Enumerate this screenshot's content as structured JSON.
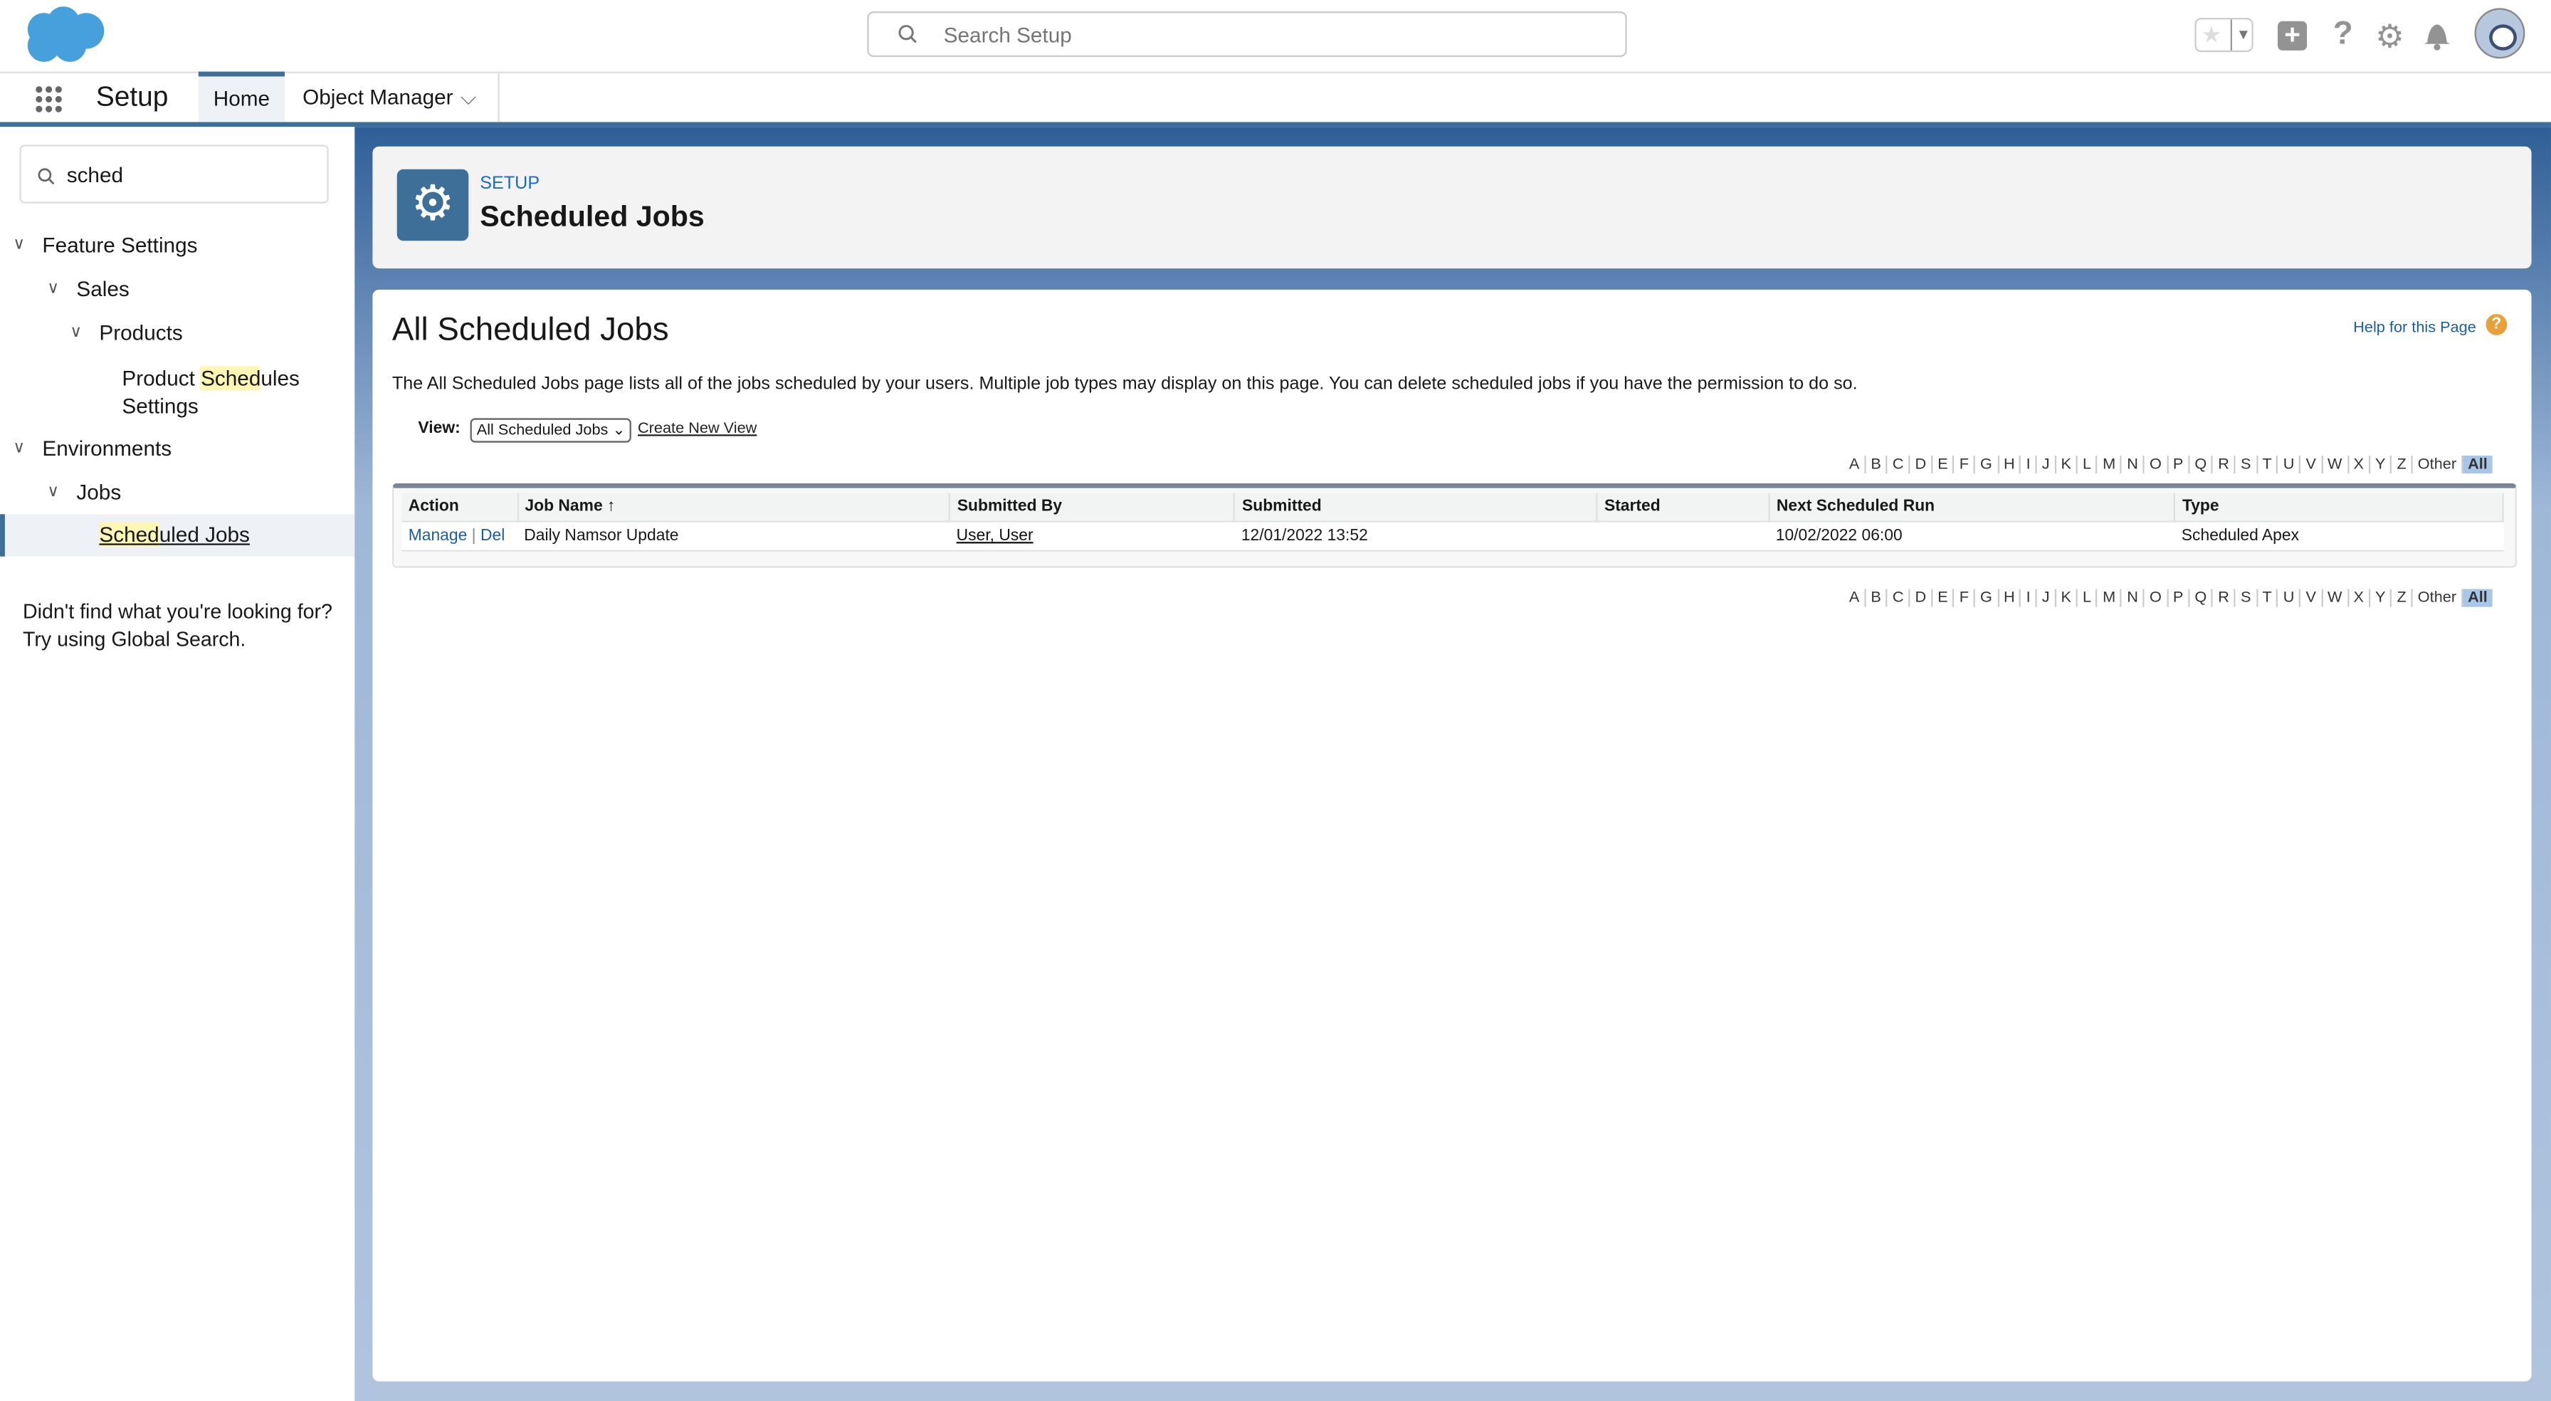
{
  "header": {
    "search_placeholder": "Search Setup",
    "icons": [
      "salesforce-cloud-logo",
      "star-icon",
      "plus-icon",
      "help-icon",
      "gear-icon",
      "bell-icon",
      "avatar"
    ]
  },
  "nav": {
    "app_name": "Setup",
    "tabs": [
      {
        "label": "Home"
      },
      {
        "label": "Object Manager"
      }
    ]
  },
  "sidebar": {
    "quickfind_value": "sched",
    "tree": [
      {
        "label": "Feature Settings"
      },
      {
        "label": "Sales"
      },
      {
        "label": "Products"
      },
      {
        "pre": "Product ",
        "hl": "Sched",
        "post": "ules",
        "line2": "Settings"
      },
      {
        "label": "Environments"
      },
      {
        "label": "Jobs"
      },
      {
        "pre": "",
        "hl": "Sched",
        "post": "uled Jobs"
      }
    ],
    "not_found_line1": "Didn't find what you're looking for?",
    "not_found_line2": "Try using Global Search."
  },
  "page_header": {
    "eyebrow": "SETUP",
    "title": "Scheduled Jobs"
  },
  "content": {
    "title": "All Scheduled Jobs",
    "help_link": "Help for this Page",
    "description": "The All Scheduled Jobs page lists all of the jobs scheduled by your users. Multiple job types may display on this page. You can delete scheduled jobs if you have the permission to do so.",
    "view_label": "View:",
    "view_selected": "All Scheduled Jobs",
    "create_view": "Create New View",
    "alpha": [
      "A",
      "B",
      "C",
      "D",
      "E",
      "F",
      "G",
      "H",
      "I",
      "J",
      "K",
      "L",
      "M",
      "N",
      "O",
      "P",
      "Q",
      "R",
      "S",
      "T",
      "U",
      "V",
      "W",
      "X",
      "Y",
      "Z",
      "Other",
      "All"
    ],
    "table": {
      "columns": [
        "Action",
        "Job Name ↑",
        "Submitted By",
        "Submitted",
        "Started",
        "Next Scheduled Run",
        "Type"
      ],
      "rows": [
        {
          "manage": "Manage",
          "sep": "|",
          "del": "Del",
          "job_name": "Daily Namsor Update",
          "submitted_by": "User, User",
          "submitted": "12/01/2022 13:52",
          "started": "",
          "next_run": "10/02/2022 06:00",
          "type": "Scheduled Apex"
        }
      ]
    }
  },
  "colors": {
    "brand_blue": "#3e6f99",
    "link": "#1b5ea6",
    "logo": "#46a0dc"
  }
}
